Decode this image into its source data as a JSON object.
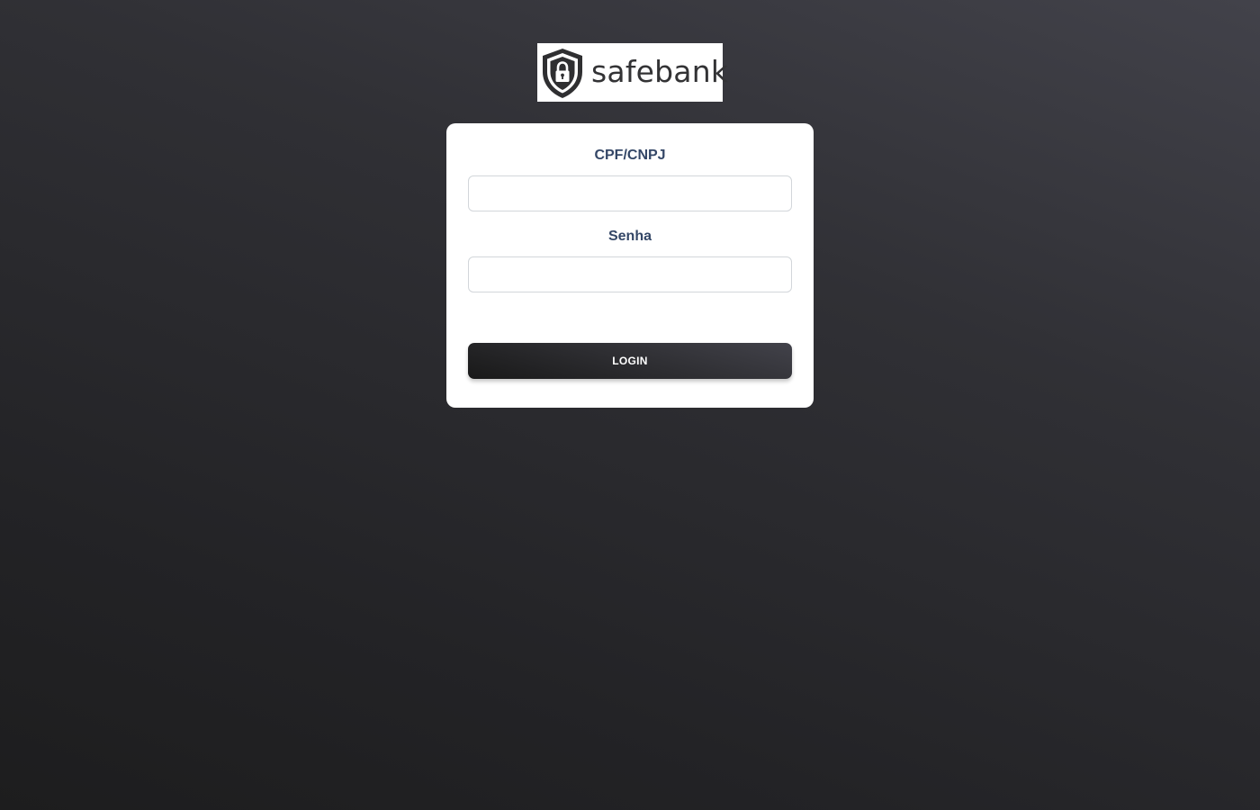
{
  "logo": {
    "text": "safebank",
    "icon": "shield-lock-icon"
  },
  "form": {
    "cpf_label": "CPF/CNPJ",
    "cpf_value": "",
    "senha_label": "Senha",
    "senha_value": "",
    "login_label": "LOGIN"
  },
  "colors": {
    "label": "#344767",
    "button_dark": "#191919",
    "button_light": "#42424a",
    "card": "#ffffff"
  }
}
